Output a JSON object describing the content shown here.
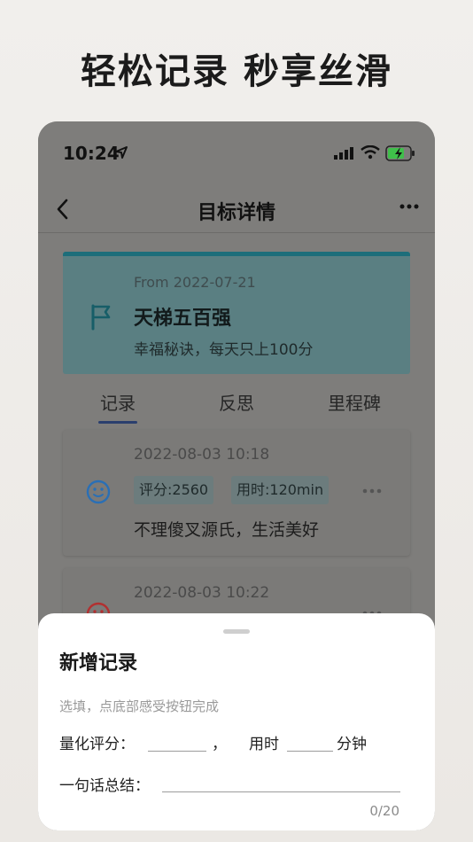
{
  "headline": "轻松记录 秒享丝滑",
  "status": {
    "time": "10:24"
  },
  "nav": {
    "title": "目标详情"
  },
  "goal": {
    "from": "From 2022-07-21",
    "title": "天梯五百强",
    "desc": "幸福秘诀，每天只上100分",
    "accent": "#1d6e7a"
  },
  "tabs": [
    {
      "label": "记录"
    },
    {
      "label": "反思"
    },
    {
      "label": "里程碑"
    }
  ],
  "records": [
    {
      "time": "2022-08-03 10:18",
      "score_tag": "评分:2560",
      "duration_tag": "用时:120min",
      "text": "不理傻叉源氏，生活美好",
      "mood": "smile-icon"
    },
    {
      "time": "2022-08-03 10:22",
      "mood": "sad-icon"
    }
  ],
  "sheet": {
    "title": "新增记录",
    "hint": "选填，点底部感受按钮完成",
    "score_label": "量化评分：",
    "comma": "，",
    "time_label": "用时",
    "minute_label": "分钟",
    "summary_label": "一句话总结：",
    "counter": "0/20"
  }
}
